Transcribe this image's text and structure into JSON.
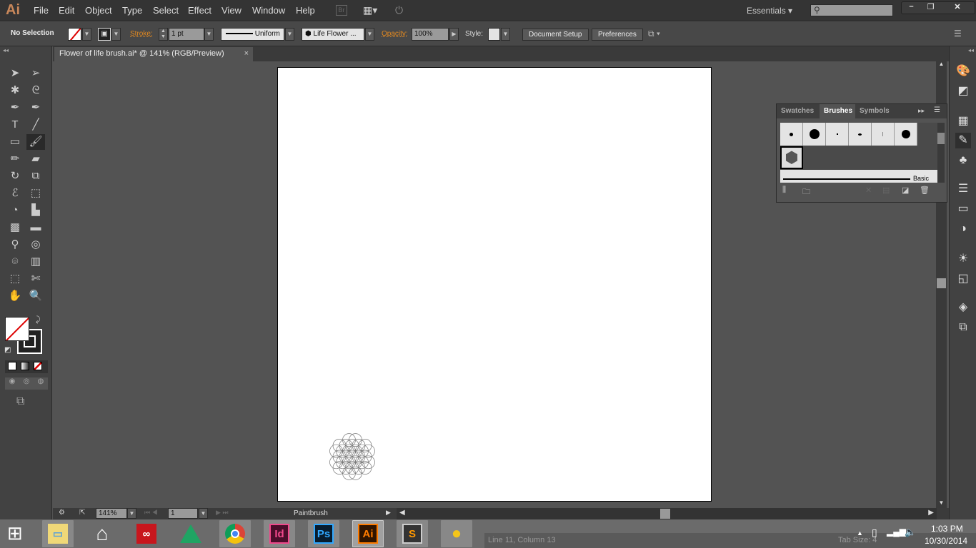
{
  "app": {
    "logo": "Ai",
    "brand_color": "#c8875a"
  },
  "menu": [
    "File",
    "Edit",
    "Object",
    "Type",
    "Select",
    "Effect",
    "View",
    "Window",
    "Help"
  ],
  "menubar_extra": {
    "bridge": "Br",
    "workspace": "Essentials",
    "search_placeholder": ""
  },
  "control": {
    "selection": "No Selection",
    "stroke_label": "Stroke:",
    "stroke_value": "1 pt",
    "profile": "Uniform",
    "brush": "Life Flower ...",
    "opacity_label": "Opacity:",
    "opacity_value": "100%",
    "style_label": "Style:",
    "document_setup": "Document Setup",
    "preferences": "Preferences"
  },
  "document": {
    "tab_title": "Flower of life brush.ai* @ 141% (RGB/Preview)",
    "close": "×"
  },
  "panel": {
    "tabs": [
      "Swatches",
      "Brushes",
      "Symbols"
    ],
    "active_tab": "Brushes",
    "basic_label": "Basic"
  },
  "statusbar": {
    "zoom": "141%",
    "artboard": "1",
    "tool": "Paintbrush"
  },
  "taskbar": {
    "apps": [
      "File Explorer",
      "Home",
      "Creative Cloud",
      "Google Drive",
      "Chrome",
      "InDesign",
      "Photoshop",
      "Illustrator",
      "Sublime Text",
      "Cyberduck"
    ],
    "labels": {
      "indesign": "Id",
      "photoshop": "Ps",
      "illustrator": "Ai",
      "sublime": "S"
    },
    "editor_status": "Line 11, Column 13",
    "tab_size": "Tab Size: 4",
    "time": "1:03 PM",
    "date": "10/30/2014"
  }
}
